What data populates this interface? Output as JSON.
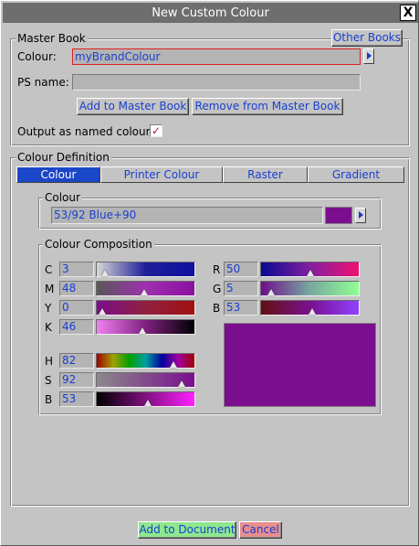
{
  "window": {
    "title": "New Custom Colour",
    "close_label": "X"
  },
  "master_book": {
    "legend": "Master Book",
    "other_books_label": "Other Books",
    "colour_label": "Colour:",
    "colour_value": "myBrandColour",
    "ps_name_label": "PS name:",
    "ps_name_value": "",
    "add_label": "Add to Master Book",
    "remove_label": "Remove from Master Book",
    "output_named_label": "Output as named colour",
    "output_named_checked": true,
    "check_glyph": "✓"
  },
  "colour_definition": {
    "legend": "Colour Definition",
    "tabs": [
      {
        "label": "Colour",
        "active": true
      },
      {
        "label": "Printer Colour",
        "active": false
      },
      {
        "label": "Raster",
        "active": false
      },
      {
        "label": "Gradient",
        "active": false
      }
    ],
    "colour_group": {
      "legend": "Colour",
      "value": "53/92 Blue+90",
      "swatch_color": "#7b0e8e"
    },
    "composition": {
      "legend": "Colour Composition",
      "cmyk": [
        {
          "label": "C",
          "value": "3",
          "fraction": 0.03,
          "gradient": [
            "#d6d6d6",
            "#1e1e9a",
            "#1010a0"
          ]
        },
        {
          "label": "M",
          "value": "48",
          "fraction": 0.48,
          "gradient": [
            "#585858",
            "#a030b0",
            "#8a10a0"
          ]
        },
        {
          "label": "Y",
          "value": "0",
          "fraction": 0.0,
          "gradient": [
            "#7a0e8c",
            "#902040",
            "#a01010"
          ]
        },
        {
          "label": "K",
          "value": "46",
          "fraction": 0.46,
          "gradient": [
            "#f080f0",
            "#802080",
            "#000000"
          ]
        }
      ],
      "rgb": [
        {
          "label": "R",
          "value": "50",
          "fraction": 0.5,
          "gradient": [
            "#0a0a90",
            "#8020a0",
            "#f01070"
          ]
        },
        {
          "label": "G",
          "value": "5",
          "fraction": 0.05,
          "gradient": [
            "#6e0e8e",
            "#78a8a0",
            "#90ff90"
          ]
        },
        {
          "label": "B",
          "value": "53",
          "fraction": 0.53,
          "gradient": [
            "#601010",
            "#7a1090",
            "#9040ff"
          ]
        }
      ],
      "hsb": [
        {
          "label": "H",
          "value": "82",
          "fraction": 0.82,
          "gradient": [
            "#a00000",
            "#a0a000",
            "#00a000",
            "#00a0a0",
            "#0000a0",
            "#a000a0",
            "#a00000"
          ]
        },
        {
          "label": "S",
          "value": "92",
          "fraction": 0.92,
          "gradient": [
            "#8a8a8a",
            "#7a0e8e"
          ]
        },
        {
          "label": "B",
          "value": "53",
          "fraction": 0.53,
          "gradient": [
            "#000000",
            "#ff20ff"
          ]
        }
      ],
      "preview_color": "#7b0e8e"
    }
  },
  "footer": {
    "add_document_label": "Add to Document",
    "cancel_label": "Cancel",
    "add_document_color": "#8ee88e",
    "cancel_color": "#e88e8e"
  }
}
